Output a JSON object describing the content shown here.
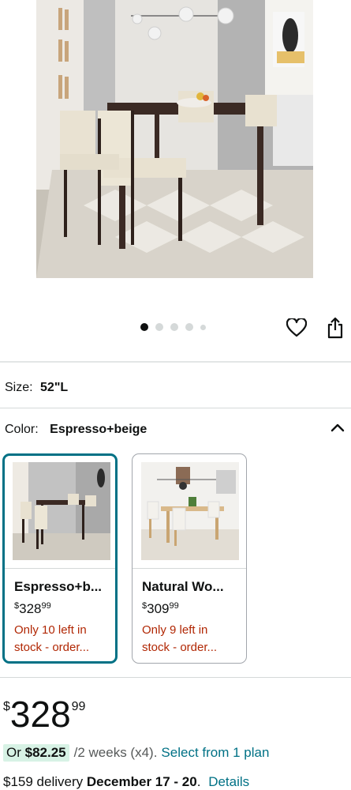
{
  "product_image": {
    "alt": "Espresso bar-height dining table with four beige upholstered chairs"
  },
  "carousel": {
    "dots": [
      {
        "active": true
      },
      {
        "active": false
      },
      {
        "active": false
      },
      {
        "active": false
      },
      {
        "active": false,
        "small": true
      }
    ],
    "icons": [
      "heart-icon",
      "share-icon"
    ]
  },
  "size": {
    "label": "Size:",
    "value": "52\"L"
  },
  "color": {
    "label": "Color:",
    "value": "Espresso+beige",
    "expanded": true,
    "options": [
      {
        "name": "Espresso+b...",
        "price_symbol": "$",
        "price_whole": "328",
        "price_fraction": "99",
        "stock_line1": "Only 10 left in",
        "stock_line2": "stock - order...",
        "selected": true
      },
      {
        "name": "Natural Wo...",
        "price_symbol": "$",
        "price_whole": "309",
        "price_fraction": "99",
        "stock_line1": "Only 9 left in",
        "stock_line2": "stock - order...",
        "selected": false
      }
    ]
  },
  "price": {
    "symbol": "$",
    "whole": "328",
    "fraction": "99"
  },
  "installment": {
    "or_text": "Or ",
    "amount": "$82.25",
    "terms": "/2 weeks (x4).",
    "link": "Select from 1 plan"
  },
  "delivery": {
    "price_text": "$159 delivery ",
    "dates": "December 17 - 20",
    "separator": ".",
    "link": "Details"
  },
  "colors": {
    "accent_teal": "#007185",
    "stock_red": "#b12704",
    "installment_bg": "#d7f2e5"
  }
}
